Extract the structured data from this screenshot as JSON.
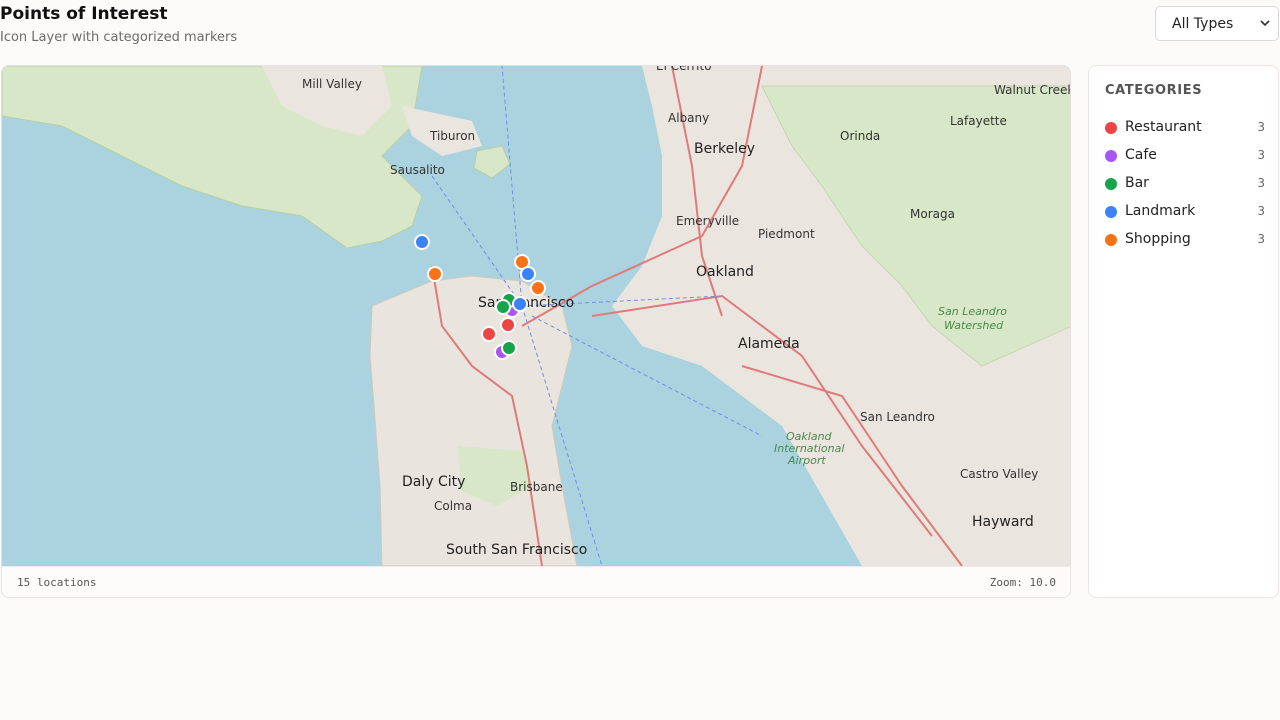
{
  "header": {
    "title": "Points of Interest",
    "subtitle": "Icon Layer with categorized markers"
  },
  "filter": {
    "selected": "All Types"
  },
  "map": {
    "place_labels": [
      "Mill Valley",
      "Tiburon",
      "Sausalito",
      "Berkeley",
      "Albany",
      "El Cerrito",
      "Emeryville",
      "Piedmont",
      "Oakland",
      "San Francisco",
      "Alameda",
      "San Leandro",
      "Daly City",
      "Brisbane",
      "Colma",
      "South San Francisco",
      "Hayward",
      "Castro Valley",
      "Orinda",
      "Lafayette",
      "Moraga",
      "Walnut Creek",
      "San Leandro Watershed",
      "Oakland International Airport"
    ],
    "footer": {
      "count_text": "15 locations",
      "zoom_text": "Zoom: 10.0"
    }
  },
  "legend": {
    "title": "CATEGORIES",
    "items": [
      {
        "label": "Restaurant",
        "count": "3",
        "color": "#ef4444"
      },
      {
        "label": "Cafe",
        "count": "3",
        "color": "#a855f7"
      },
      {
        "label": "Bar",
        "count": "3",
        "color": "#16a34a"
      },
      {
        "label": "Landmark",
        "count": "3",
        "color": "#3b82f6"
      },
      {
        "label": "Shopping",
        "count": "3",
        "color": "#f97316"
      }
    ]
  }
}
